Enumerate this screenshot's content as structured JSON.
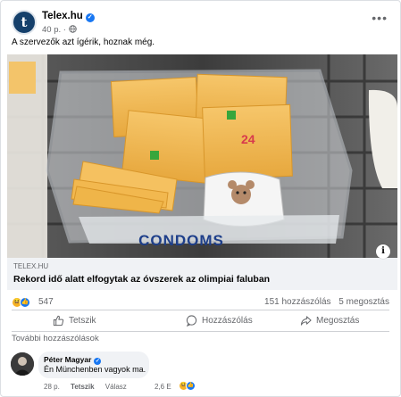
{
  "post": {
    "page_name": "Telex.hu",
    "time": "40 p.",
    "audience_icon": "globe-icon",
    "more_icon": "more-icon",
    "text": "A szervezők azt ígérik, hoznak még."
  },
  "image": {
    "box_label": "CONDOMS"
  },
  "link": {
    "domain": "TELEX.HU",
    "title": "Rekord idő alatt elfogytak az óvszerek az olimpiai faluban"
  },
  "stats": {
    "reactions_count": "547",
    "comments": "151 hozzászólás",
    "shares": "5 megosztás"
  },
  "actions": {
    "like": "Tetszik",
    "comment": "Hozzászólás",
    "share": "Megosztás"
  },
  "more_comments": "További hozzászólások",
  "comment": {
    "author": "Péter Magyar",
    "text": "Én Münchenben vagyok ma.",
    "time": "28 p.",
    "like": "Tetszik",
    "reply": "Válasz",
    "reaction_count": "2,6 E"
  },
  "colors": {
    "brand_blue": "#1877f2",
    "avatar_navy": "#15406b",
    "muted_text": "#65676b",
    "surface": "#f0f2f5"
  }
}
